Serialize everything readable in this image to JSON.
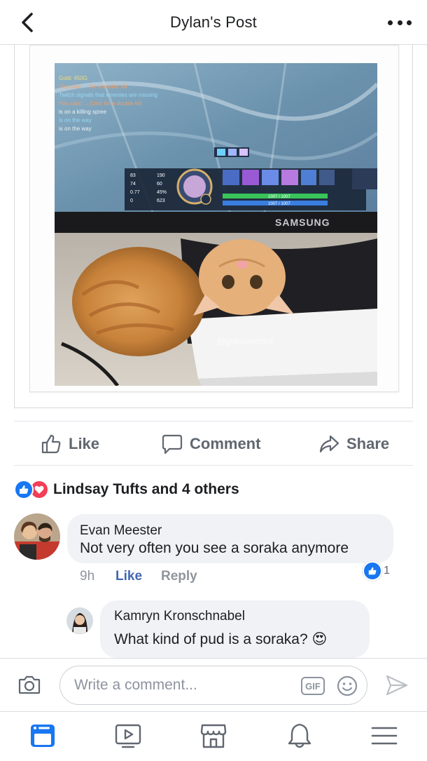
{
  "header": {
    "title": "Dylan's Post",
    "back_icon": "chevron-left-icon",
    "more_icon": "more-horizontal-icon"
  },
  "post": {
    "image": {
      "monitor_brand": "SAMSUNG",
      "watermark": "@grouprecowz",
      "hud_stats": [
        "83",
        "190",
        "74",
        "60",
        "0.77",
        "45%",
        "0",
        "623"
      ],
      "hud_bar_text": [
        "1007 / 1007",
        "1007 / 1007"
      ]
    }
  },
  "actions": {
    "like_label": "Like",
    "comment_label": "Comment",
    "share_label": "Share"
  },
  "reactions": {
    "summary": "Lindsay Tufts and 4 others",
    "types": [
      "like",
      "love"
    ]
  },
  "comments": [
    {
      "author": "Evan Meester",
      "text": "Not very often you see a soraka anymore",
      "time": "9h",
      "like_label": "Like",
      "reply_label": "Reply",
      "like_count": "1"
    },
    {
      "author": "Kamryn Kronschnabel",
      "text": "What kind of pud is a soraka?",
      "emoji": "😍"
    }
  ],
  "composer": {
    "placeholder": "Write a comment...",
    "gif_label": "GIF"
  },
  "colors": {
    "accent": "#1877f2",
    "love": "#f33e58",
    "link": "#4267b2",
    "muted": "#606770"
  },
  "tabbar": {
    "items": [
      "news-feed-icon",
      "watch-icon",
      "marketplace-icon",
      "notifications-icon",
      "menu-icon"
    ],
    "active": "news-feed-icon"
  }
}
